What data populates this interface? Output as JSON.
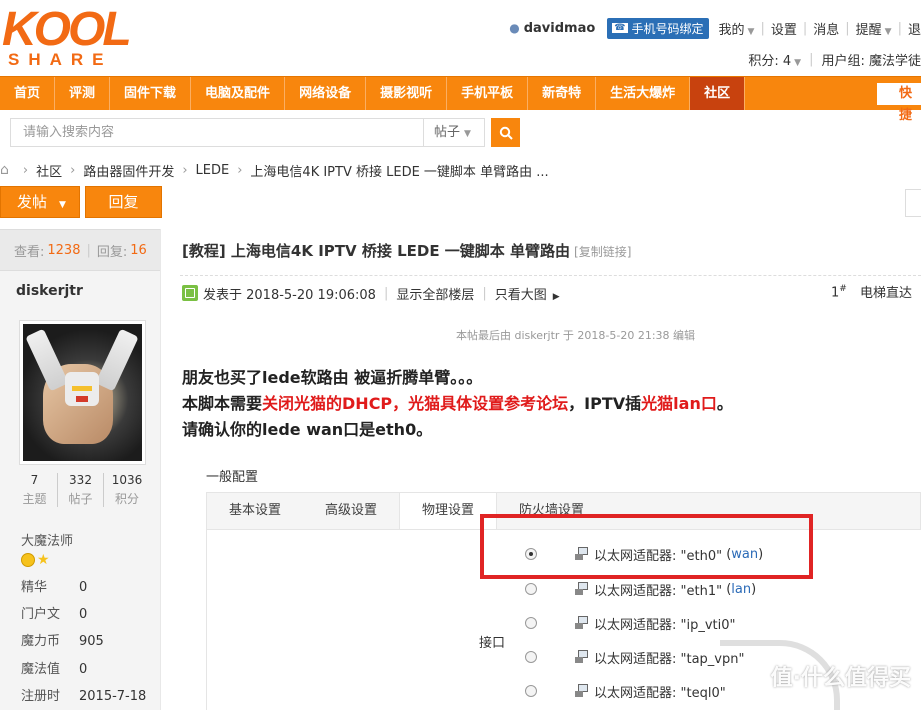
{
  "logo": {
    "top": "KOOL",
    "bottom": "SHARE"
  },
  "userbar": {
    "username": "davidmao",
    "bind_label": "手机号码绑定",
    "items": [
      "我的",
      "设置",
      "消息",
      "提醒",
      "退"
    ],
    "points_label": "积分: 4",
    "group_label": "用户组: 魔法学徒"
  },
  "nav": {
    "items": [
      "首页",
      "评测",
      "固件下载",
      "电脑及配件",
      "网络设备",
      "摄影视听",
      "手机平板",
      "新奇特",
      "生活大爆炸",
      "社区"
    ],
    "quick": "快捷"
  },
  "search": {
    "placeholder": "请输入搜索内容",
    "type": "帖子"
  },
  "breadcrumb": [
    "社区",
    "路由器固件开发",
    "LEDE",
    "上海电信4K IPTV 桥接 LEDE 一键脚本 单臂路由 ..."
  ],
  "buttons": {
    "post": "发帖",
    "reply": "回复"
  },
  "sidebar": {
    "views_label": "查看:",
    "views": "1238",
    "replies_label": "回复:",
    "replies": "16",
    "author": "diskerjtr",
    "stats": [
      {
        "v": "7",
        "k": "主题"
      },
      {
        "v": "332",
        "k": "帖子"
      },
      {
        "v": "1036",
        "k": "积分"
      }
    ],
    "rank": "大魔法师",
    "info": [
      {
        "k": "精华",
        "v": "0"
      },
      {
        "k": "门户文",
        "v": "0"
      },
      {
        "k": "魔力币",
        "v": "905"
      },
      {
        "k": "魔法值",
        "v": "0"
      },
      {
        "k": "注册时",
        "v": "2015-7-18"
      }
    ]
  },
  "post": {
    "title": "[教程] 上海电信4K IPTV 桥接 LEDE 一键脚本 单臂路由",
    "copy_link": "[复制链接]",
    "posted": "发表于 2018-5-20 19:06:08",
    "show_all": "显示全部楼层",
    "view_large": "只看大图",
    "floor": "1",
    "floor_sup": "#",
    "elevator": "电梯直达",
    "edited": "本帖最后由 diskerjtr 于 2018-5-20 21:38 编辑",
    "line1": "朋友也买了lede软路由 被逼折腾单臂。。。",
    "line2_a": "本脚本需要",
    "line2_b": "关闭光猫的DHCP，光猫具体设置参考论坛",
    "line2_c": "，IPTV插",
    "line2_d": "光猫lan口",
    "line2_e": "。",
    "line3": "请确认你的lede wan口是eth0。"
  },
  "config": {
    "section": "一般配置",
    "tabs": [
      "基本设置",
      "高级设置",
      "物理设置",
      "防火墙设置"
    ],
    "iface_label": "接口",
    "adapters": [
      {
        "label": "以太网适配器: \"eth0\"",
        "net": "wan",
        "selected": true
      },
      {
        "label": "以太网适配器: \"eth1\"",
        "net": "lan",
        "selected": false
      },
      {
        "label": "以太网适配器: \"ip_vti0\"",
        "net": "",
        "selected": false
      },
      {
        "label": "以太网适配器: \"tap_vpn\"",
        "net": "",
        "selected": false
      },
      {
        "label": "以太网适配器: \"teql0\"",
        "net": "",
        "selected": false
      }
    ]
  },
  "watermark": "值·什么值得买",
  "colors": {
    "accent": "#f8860d",
    "active_nav": "#c8420e",
    "highlight": "#e02424"
  }
}
